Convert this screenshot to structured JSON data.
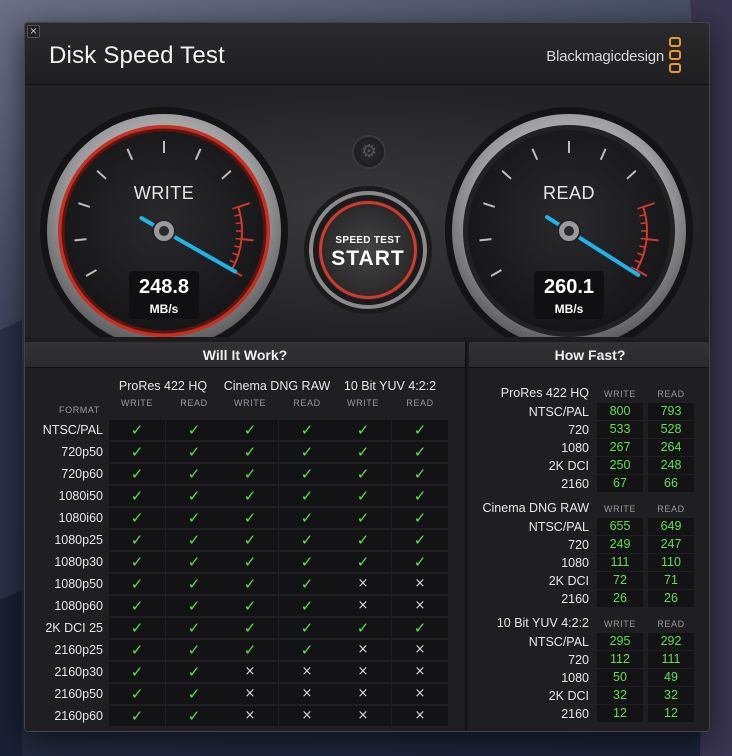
{
  "window": {
    "title": "Disk Speed Test",
    "brand": "Blackmagicdesign",
    "close_glyph": "×"
  },
  "colors": {
    "accent_red": "#d23a2a",
    "needle_blue": "#1eb4ea",
    "check_green": "#5fe14a",
    "brand_orange": "#e89a2c"
  },
  "gauges": {
    "write": {
      "label": "WRITE",
      "value": "248.8",
      "unit": "MB/s"
    },
    "read": {
      "label": "READ",
      "value": "260.1",
      "unit": "MB/s"
    }
  },
  "settings": {
    "icon": "gear-icon",
    "glyph": "⚙"
  },
  "start_button": {
    "small": "SPEED TEST",
    "big": "START"
  },
  "will_it_work": {
    "title": "Will It Work?",
    "format_header": "FORMAT",
    "write_header": "WRITE",
    "read_header": "READ",
    "groups": [
      "ProRes 422 HQ",
      "Cinema DNG RAW",
      "10 Bit YUV 4:2:2"
    ],
    "yes_glyph": "✓",
    "no_glyph": "×",
    "rows": [
      {
        "format": "NTSC/PAL",
        "cells": [
          1,
          1,
          1,
          1,
          1,
          1
        ]
      },
      {
        "format": "720p50",
        "cells": [
          1,
          1,
          1,
          1,
          1,
          1
        ]
      },
      {
        "format": "720p60",
        "cells": [
          1,
          1,
          1,
          1,
          1,
          1
        ]
      },
      {
        "format": "1080i50",
        "cells": [
          1,
          1,
          1,
          1,
          1,
          1
        ]
      },
      {
        "format": "1080i60",
        "cells": [
          1,
          1,
          1,
          1,
          1,
          1
        ]
      },
      {
        "format": "1080p25",
        "cells": [
          1,
          1,
          1,
          1,
          1,
          1
        ]
      },
      {
        "format": "1080p30",
        "cells": [
          1,
          1,
          1,
          1,
          1,
          1
        ]
      },
      {
        "format": "1080p50",
        "cells": [
          1,
          1,
          1,
          1,
          0,
          0
        ]
      },
      {
        "format": "1080p60",
        "cells": [
          1,
          1,
          1,
          1,
          0,
          0
        ]
      },
      {
        "format": "2K DCI 25",
        "cells": [
          1,
          1,
          1,
          1,
          1,
          1
        ]
      },
      {
        "format": "2160p25",
        "cells": [
          1,
          1,
          1,
          1,
          0,
          0
        ]
      },
      {
        "format": "2160p30",
        "cells": [
          1,
          1,
          0,
          0,
          0,
          0
        ]
      },
      {
        "format": "2160p50",
        "cells": [
          1,
          1,
          0,
          0,
          0,
          0
        ]
      },
      {
        "format": "2160p60",
        "cells": [
          1,
          1,
          0,
          0,
          0,
          0
        ]
      }
    ]
  },
  "how_fast": {
    "title": "How Fast?",
    "write_header": "WRITE",
    "read_header": "READ",
    "groups": [
      {
        "name": "ProRes 422 HQ",
        "rows": [
          {
            "label": "NTSC/PAL",
            "write": "800",
            "read": "793"
          },
          {
            "label": "720",
            "write": "533",
            "read": "528"
          },
          {
            "label": "1080",
            "write": "267",
            "read": "264"
          },
          {
            "label": "2K DCI",
            "write": "250",
            "read": "248"
          },
          {
            "label": "2160",
            "write": "67",
            "read": "66"
          }
        ]
      },
      {
        "name": "Cinema DNG RAW",
        "rows": [
          {
            "label": "NTSC/PAL",
            "write": "655",
            "read": "649"
          },
          {
            "label": "720",
            "write": "249",
            "read": "247"
          },
          {
            "label": "1080",
            "write": "111",
            "read": "110"
          },
          {
            "label": "2K DCI",
            "write": "72",
            "read": "71"
          },
          {
            "label": "2160",
            "write": "26",
            "read": "26"
          }
        ]
      },
      {
        "name": "10 Bit YUV 4:2:2",
        "rows": [
          {
            "label": "NTSC/PAL",
            "write": "295",
            "read": "292"
          },
          {
            "label": "720",
            "write": "112",
            "read": "111"
          },
          {
            "label": "1080",
            "write": "50",
            "read": "49"
          },
          {
            "label": "2K DCI",
            "write": "32",
            "read": "32"
          },
          {
            "label": "2160",
            "write": "12",
            "read": "12"
          }
        ]
      }
    ]
  }
}
